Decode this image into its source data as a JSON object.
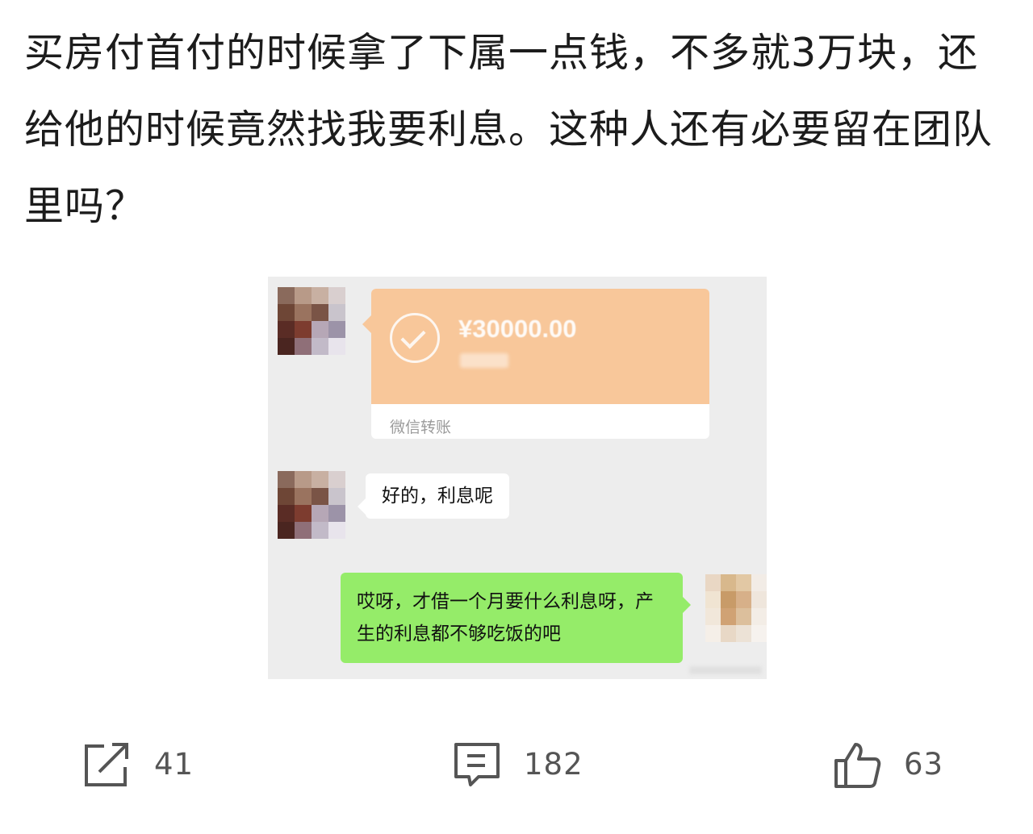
{
  "post": {
    "text": "买房付首付的时候拿了下属一点钱，不多就3万块，还给他的时候竟然找我要利息。这种人还有必要留在团队里吗？"
  },
  "chat": {
    "transfer": {
      "amount": "¥30000.00",
      "label": "微信转账"
    },
    "reply_text": "好的，利息呢",
    "own_text": "哎呀，才借一个月要什么利息呀，产生的利息都不够吃饭的吧"
  },
  "actions": {
    "share": {
      "icon": "share-icon",
      "count": "41"
    },
    "comment": {
      "icon": "comment-icon",
      "count": "182"
    },
    "like": {
      "icon": "thumbs-up-icon",
      "count": "63"
    }
  },
  "colors": {
    "transfer_orange": "#f8c79a",
    "chat_background": "#ededed",
    "green_bubble": "#95ec69",
    "icon_gray": "#555555"
  }
}
